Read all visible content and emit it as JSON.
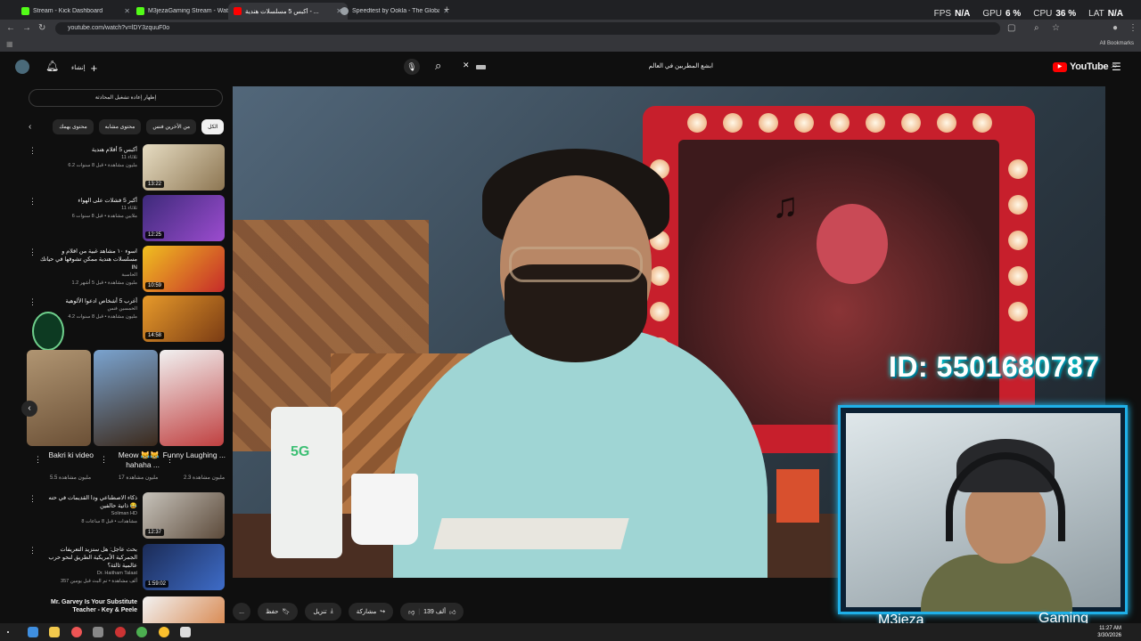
{
  "browser": {
    "tabs": [
      {
        "title": "Stream - Kick Dashboard",
        "color": "#53fc18"
      },
      {
        "title": "M3jezaGaming Stream - Watch",
        "color": "#53fc18"
      },
      {
        "title": "أكبس 5 مسلسلات هندية - ...",
        "color": "#ff0000"
      },
      {
        "title": "Speedtest by Ookla - The Global",
        "color": "#9aa0a6"
      }
    ],
    "url": "youtube.com/watch?v=lDY3zquuF0o",
    "bookmarks_label": "All Bookmarks",
    "perf": [
      {
        "label": "FPS",
        "value": "N/A"
      },
      {
        "label": "GPU",
        "value": "6 %"
      },
      {
        "label": "CPU",
        "value": "36 %"
      },
      {
        "label": "LAT",
        "value": "N/A"
      }
    ]
  },
  "youtube": {
    "logo_text": "YouTube",
    "logo_region": "JO",
    "create_label": "إنشاء",
    "search_value": "ابشع المطربين في العالم",
    "replay_chat": "إظهار إعادة تشغيل المحادثة",
    "chips": [
      "الكل",
      "من الأخرين فنس",
      "محتوى مشابه",
      "محتوى يهمك"
    ],
    "actions": {
      "more": "...",
      "save": "حفظ",
      "download": "تنزيل",
      "share": "مشاركة",
      "likes": "139 ألف"
    }
  },
  "recommendations": [
    {
      "title": "أكبس 5 أفلام هندية",
      "channel": "ثلاثاء 11",
      "meta": "6.2 مليون مشاهدة • قبل 8 سنوات",
      "duration": "13:22",
      "c1": "#e6dcc2",
      "c2": "#8d7652"
    },
    {
      "title": "أكبر 5 فشلات على الهواء",
      "channel": "ثلاثاء 11",
      "meta": "6 ملايين مشاهدة • قبل 8 سنوات",
      "duration": "12:25",
      "c1": "#3d2a7a",
      "c2": "#9c4ccf"
    },
    {
      "title": "اسوء ١٠ مشاهد غبية من افلام و مسلسلات هندية ممكن تشوفها في حياتك IN",
      "channel": "الحاسبة",
      "meta": "1.2 مليون مشاهدة • قبل 5 أشهر",
      "duration": "10:59",
      "c1": "#f0c020",
      "c2": "#c62a2a"
    },
    {
      "title": "أغرب 5 أشخاص ادعوا الألوهية",
      "channel": "الخمسين فنس",
      "meta": "4.2 مليون مشاهدة • قبل 8 سنوات",
      "duration": "14:58",
      "c1": "#e79a2a",
      "c2": "#7a3b14"
    },
    {
      "title": "ذكاء الاصطناعي ودا القديمات في حته ذاتية حالفين 😂",
      "channel": "Soliman HD",
      "meta": "8 مشاهدات • قبل 8 ساعات",
      "duration": "12:37",
      "c1": "#c7c3bb",
      "c2": "#5c4a3a"
    },
    {
      "title": "بحث عاجل: هل ستزيد التعريفات الجمركية الأمريكية الطريق لنحو حرب عالمية ثالثة؟",
      "channel": "Dr. Haitham Talaat",
      "meta": "357 ألف مشاهدة • تم البث قبل يومين",
      "duration": "1:59:02",
      "c1": "#1b2b56",
      "c2": "#3e6cc8"
    },
    {
      "title": "Mr. Garvey Is Your Substitute Teacher - Key & Peele",
      "channel": "Key & Peele",
      "meta": "",
      "duration": "",
      "c1": "#f2f2f2",
      "c2": "#d57a3a"
    }
  ],
  "shorts": [
    {
      "title": "Bakri ki video",
      "views": "5.5 مليون مشاهدة",
      "c1": "#b09572",
      "c2": "#6b5036"
    },
    {
      "title": "Meow 😹😹 hahaha ...",
      "views": "17 مليون مشاهدة",
      "c1": "#7aa3cf",
      "c2": "#3c2a1c"
    },
    {
      "title": "Funny Laughing ...",
      "views": "2.3 مليون مشاهدة",
      "c1": "#f1f1f1",
      "c2": "#c04040"
    }
  ],
  "overlay": {
    "id_text": "ID: 5501680787",
    "name_left": "M3jeza",
    "name_right": "Gaming",
    "router_label": "5G"
  },
  "taskbar": {
    "time": "11:27 AM",
    "date": "3/30/2026"
  }
}
